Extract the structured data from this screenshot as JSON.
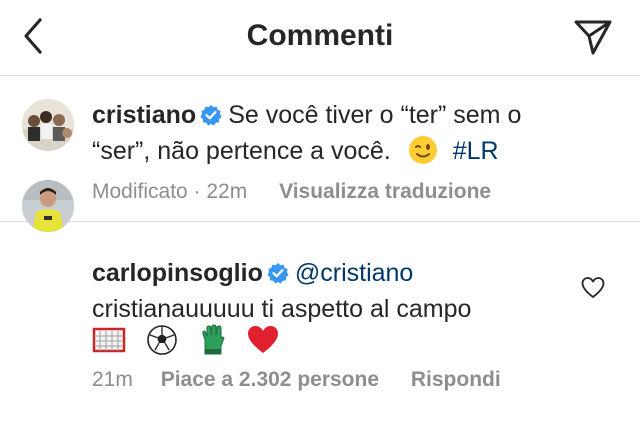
{
  "header": {
    "title": "Commenti"
  },
  "caption": {
    "username": "cristiano",
    "text_line1": "Se você tiver o “ter” sem o",
    "text_line2": "“ser”, não pertence a você.",
    "hashtag": "#LR",
    "edited_time": "Modificato · 22m",
    "translate_label": "Visualizza traduzione"
  },
  "comment": {
    "username": "carlopinsoglio",
    "mention": "@cristiano",
    "text": "cristianauuuuu ti aspetto al campo",
    "emojis": [
      "goal-net",
      "soccer-ball",
      "goalkeeper-glove",
      "red-heart"
    ],
    "time": "21m",
    "likes": "Piace a 2.302 persone",
    "reply_label": "Rispondi"
  },
  "colors": {
    "text": "#262626",
    "secondary": "#8e8e8e",
    "link": "#00376b",
    "verified": "#3897f0",
    "divider": "#dbdbdb"
  }
}
